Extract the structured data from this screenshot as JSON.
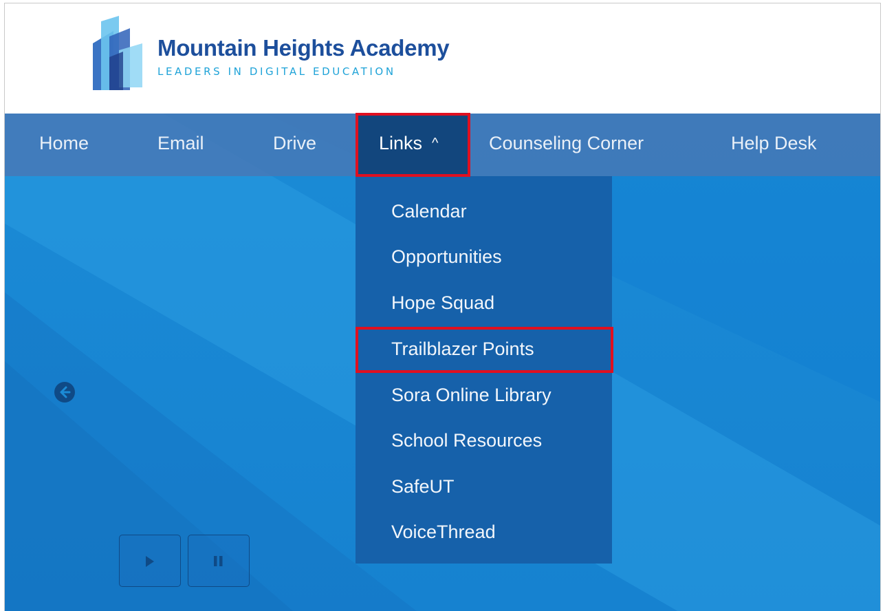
{
  "site": {
    "title": "Mountain Heights Academy",
    "tagline": "LEADERS IN DIGITAL EDUCATION"
  },
  "nav": {
    "items": [
      {
        "label": "Home"
      },
      {
        "label": "Email"
      },
      {
        "label": "Drive"
      },
      {
        "label": "Links"
      },
      {
        "label": "Counseling Corner"
      },
      {
        "label": "Help Desk"
      }
    ]
  },
  "links_menu": {
    "items": [
      {
        "label": "Calendar"
      },
      {
        "label": "Opportunities"
      },
      {
        "label": "Hope Squad"
      },
      {
        "label": "Trailblazer Points"
      },
      {
        "label": "Sora Online Library"
      },
      {
        "label": "School Resources"
      },
      {
        "label": "SafeUT"
      },
      {
        "label": "VoiceThread"
      }
    ]
  },
  "carousel": {
    "prev_icon": "arrow-left-icon",
    "play_icon": "play-icon",
    "pause_icon": "pause-icon"
  },
  "colors": {
    "nav_bg": "#4878b4",
    "nav_active": "#12467d",
    "dropdown_bg": "#1661aa",
    "hero_bg": "#1b8bd6",
    "highlight": "#e01020",
    "brand_navy": "#1d4f9c",
    "brand_cyan": "#1fa3d8"
  }
}
